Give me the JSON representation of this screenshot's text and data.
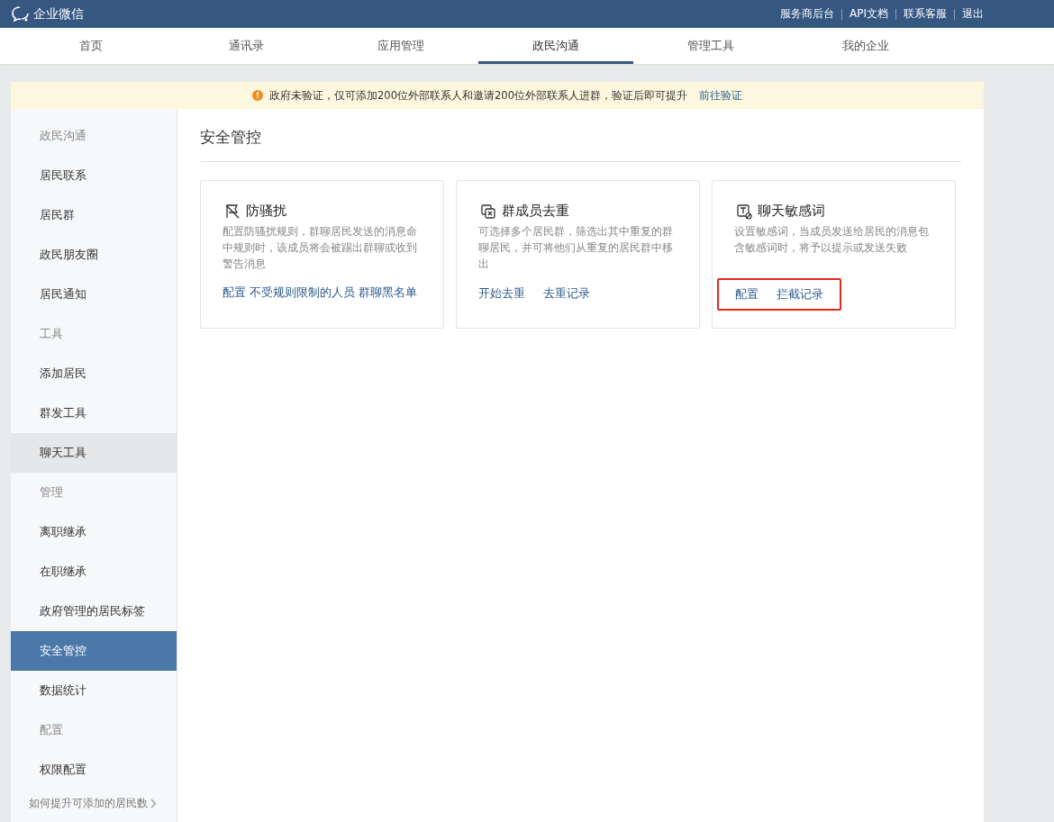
{
  "header": {
    "logo": "企业微信",
    "links": [
      "服务商后台",
      "API文档",
      "联系客服",
      "退出"
    ]
  },
  "nav": [
    {
      "label": "首页",
      "selected": false
    },
    {
      "label": "通讯录",
      "selected": false
    },
    {
      "label": "应用管理",
      "selected": false
    },
    {
      "label": "政民沟通",
      "selected": true
    },
    {
      "label": "管理工具",
      "selected": false
    },
    {
      "label": "我的企业",
      "selected": false
    }
  ],
  "notice": {
    "icon": "!",
    "text": "政府未验证，仅可添加200位外部联系人和邀请200位外部联系人进群，验证后即可提升",
    "link": "前往验证"
  },
  "sidebar": {
    "items": [
      {
        "kind": "heading",
        "label": "政民沟通"
      },
      {
        "kind": "item",
        "label": "居民联系",
        "selected": false,
        "hovered": false
      },
      {
        "kind": "item",
        "label": "居民群",
        "selected": false,
        "hovered": false
      },
      {
        "kind": "item",
        "label": "政民朋友圈",
        "selected": false,
        "hovered": false
      },
      {
        "kind": "item",
        "label": "居民通知",
        "selected": false,
        "hovered": false
      },
      {
        "kind": "heading",
        "label": "工具"
      },
      {
        "kind": "item",
        "label": "添加居民",
        "selected": false,
        "hovered": false
      },
      {
        "kind": "item",
        "label": "群发工具",
        "selected": false,
        "hovered": false
      },
      {
        "kind": "item",
        "label": "聊天工具",
        "selected": false,
        "hovered": true
      },
      {
        "kind": "heading",
        "label": "管理"
      },
      {
        "kind": "item",
        "label": "离职继承",
        "selected": false,
        "hovered": false
      },
      {
        "kind": "item",
        "label": "在职继承",
        "selected": false,
        "hovered": false
      },
      {
        "kind": "item",
        "label": "政府管理的居民标签",
        "selected": false,
        "hovered": false
      },
      {
        "kind": "item",
        "label": "安全管控",
        "selected": true,
        "hovered": false
      },
      {
        "kind": "item",
        "label": "数据统计",
        "selected": false,
        "hovered": false
      },
      {
        "kind": "heading",
        "label": "配置"
      },
      {
        "kind": "item",
        "label": "权限配置",
        "selected": false,
        "hovered": false
      }
    ],
    "footer_link": "如何提升可添加的居民数"
  },
  "content": {
    "title": "安全管控",
    "cards": [
      {
        "kind": "harass",
        "title": "防骚扰",
        "description": "配置防骚扰规则，群聊居民发送的消息命中规则时，该成员将会被踢出群聊或收到警告消息",
        "links": [
          "配置",
          "不受规则限制的人员",
          "群聊黑名单"
        ],
        "highlighted": false
      },
      {
        "kind": "dedupe",
        "title": "群成员去重",
        "description": "可选择多个居民群，筛选出其中重复的群聊居民，并可将他们从重复的居民群中移出",
        "links": [
          "开始去重",
          "去重记录"
        ],
        "highlighted": false
      },
      {
        "kind": "words",
        "title": "聊天敏感词",
        "description": "设置敏感词，当成员发送给居民的消息包含敏感词时，将予以提示或发送失败",
        "links": [
          "配置",
          "拦截记录"
        ],
        "highlighted": true
      }
    ]
  }
}
